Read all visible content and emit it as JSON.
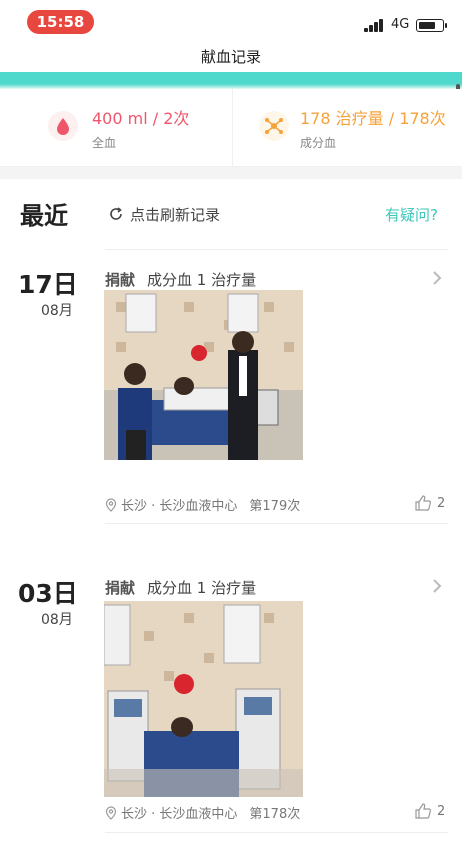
{
  "status_bar": {
    "time": "15:58",
    "network": "4G"
  },
  "nav": {
    "title": "献血记录"
  },
  "stats": {
    "whole_blood": {
      "value": "400 ml / 2次",
      "label": "全血",
      "color": "#f0566b"
    },
    "apheresis": {
      "value": "178 治疗量 / 178次",
      "label": "成分血",
      "color": "#f5a23a"
    }
  },
  "section": {
    "title": "最近",
    "refresh_label": "点击刷新记录",
    "question_label": "有疑问?"
  },
  "records": [
    {
      "day": "17日",
      "month": "08月",
      "type": "捐献",
      "detail": "成分血 1 治疗量",
      "location": "长沙 · 长沙血液中心",
      "count": "第179次",
      "likes": "2"
    },
    {
      "day": "03日",
      "month": "08月",
      "type": "捐献",
      "detail": "成分血 1 治疗量",
      "location": "长沙 · 长沙血液中心",
      "count": "第178次",
      "likes": "2"
    }
  ],
  "colors": {
    "accent": "#4fd9cd",
    "link": "#3dc6b9",
    "time_pill": "#e8473f"
  }
}
